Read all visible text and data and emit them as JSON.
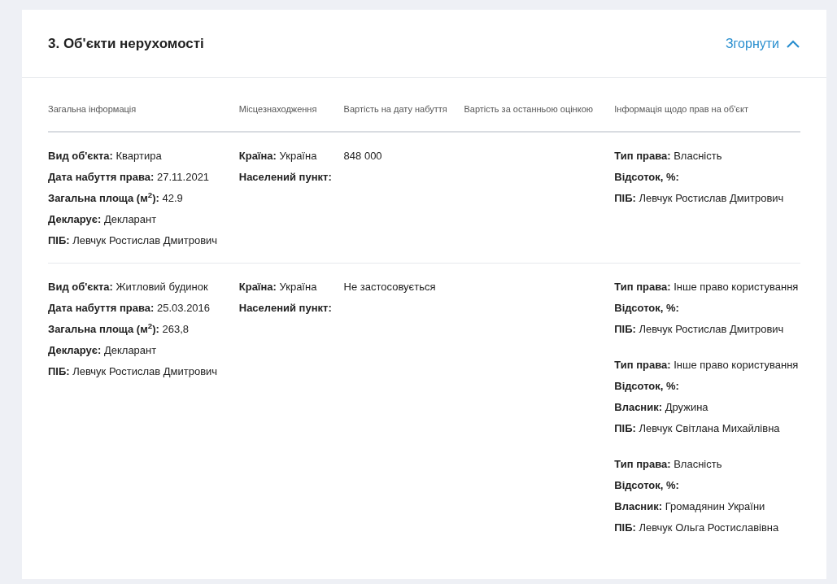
{
  "section": {
    "title": "3. Об'єкти нерухомості",
    "collapse_label": "Згорнути",
    "expanded": true
  },
  "table": {
    "columns": [
      "Загальна інформація",
      "Місцезнаходження",
      "Вартість на дату набуття",
      "Вартість за останньою оцінкою",
      "Інформація щодо прав на об'єкт"
    ],
    "rows": [
      {
        "general": [
          {
            "label": "Вид об'єкта:",
            "value": "Квартира"
          },
          {
            "label": "Дата набуття права:",
            "value": "27.11.2021"
          },
          {
            "label": "Загальна площа (м$^{2}$):",
            "value": "42.9"
          },
          {
            "label": "Декларує:",
            "value": "Декларант"
          },
          {
            "label": "ПІБ:",
            "value": "Левчук Ростислав Дмитрович"
          }
        ],
        "location": [
          {
            "label": "Країна:",
            "value": "Україна"
          },
          {
            "label": "Населений пункт:"
          }
        ],
        "cost_at_acquisition": "848 000",
        "rights": [
          [
            {
              "label": "Тип права:",
              "value": "Власність"
            },
            {
              "label": "Відсоток, %:"
            },
            {
              "label": "ПІБ:",
              "value": "Левчук Ростислав Дмитрович"
            }
          ]
        ]
      },
      {
        "general": [
          {
            "label": "Вид об'єкта:",
            "value": "Житловий будинок"
          },
          {
            "label": "Дата набуття права:",
            "value": "25.03.2016"
          },
          {
            "label": "Загальна площа (м$^{2}$):",
            "value": "263,8"
          },
          {
            "label": "Декларує:",
            "value": "Декларант"
          },
          {
            "label": "ПІБ:",
            "value": "Левчук Ростислав Дмитрович"
          }
        ],
        "location": [
          {
            "label": "Країна:",
            "value": "Україна"
          },
          {
            "label": "Населений пункт:"
          }
        ],
        "cost_at_acquisition": "Не застосовується",
        "rights": [
          [
            {
              "label": "Тип права:",
              "value": "Інше право користування"
            },
            {
              "label": "Відсоток, %:"
            },
            {
              "label": "ПІБ:",
              "value": "Левчук Ростислав Дмитрович"
            }
          ],
          [
            {
              "label": "Тип права:",
              "value": "Інше право користування"
            },
            {
              "label": "Відсоток, %:"
            },
            {
              "label": "Власник:",
              "value": "Дружина"
            },
            {
              "label": "ПІБ:",
              "value": "Левчук Світлана Михайлівна"
            }
          ],
          [
            {
              "label": "Тип права:",
              "value": "Власність"
            },
            {
              "label": "Відсоток, %:"
            },
            {
              "label": "Власник:",
              "value": "Громадянин України"
            },
            {
              "label": "ПІБ:",
              "value": "Левчук Ольга Ростиславівна"
            }
          ]
        ]
      }
    ]
  }
}
